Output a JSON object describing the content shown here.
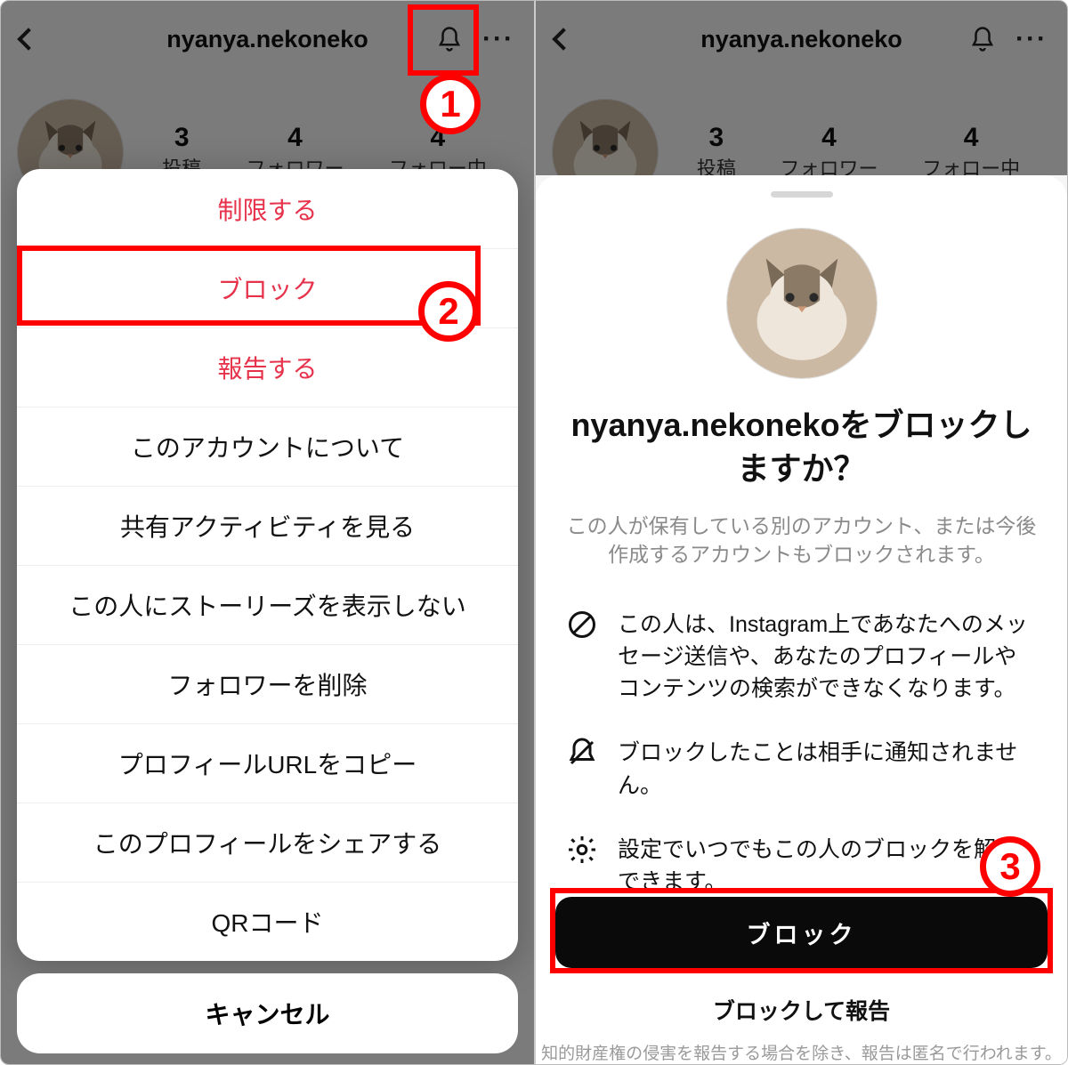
{
  "profile": {
    "username": "nyanya.nekoneko",
    "stats": [
      {
        "count": "3",
        "label": "投稿"
      },
      {
        "count": "4",
        "label": "フォロワー"
      },
      {
        "count": "4",
        "label": "フォロー中"
      }
    ]
  },
  "actionSheet": {
    "items": [
      {
        "label": "制限する",
        "danger": true
      },
      {
        "label": "ブロック",
        "danger": true
      },
      {
        "label": "報告する",
        "danger": true
      },
      {
        "label": "このアカウントについて",
        "danger": false
      },
      {
        "label": "共有アクティビティを見る",
        "danger": false
      },
      {
        "label": "この人にストーリーズを表示しない",
        "danger": false
      },
      {
        "label": "フォロワーを削除",
        "danger": false
      },
      {
        "label": "プロフィールURLをコピー",
        "danger": false
      },
      {
        "label": "このプロフィールをシェアする",
        "danger": false
      },
      {
        "label": "QRコード",
        "danger": false
      }
    ],
    "cancel": "キャンセル"
  },
  "confirm": {
    "title": "nyanya.nekonekoをブロックしますか？",
    "subtitle": "この人が保有している別のアカウント、または今後作成するアカウントもブロックされます。",
    "info": [
      "この人は、Instagram上であなたへのメッセージ送信や、あなたのプロフィールやコンテンツの検索ができなくなります。",
      "ブロックしたことは相手に通知されません。",
      "設定でいつでもこの人のブロックを解除できます。"
    ],
    "primary": "ブロック",
    "secondary": "ブロックして報告",
    "disclaimer": "知的財産権の侵害を報告する場合を除き、報告は匿名で行われます。"
  },
  "annotations": {
    "step1": "1",
    "step2": "2",
    "step3": "3"
  }
}
